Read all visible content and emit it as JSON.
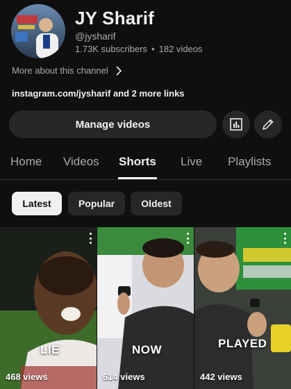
{
  "channel": {
    "name": "JY Sharif",
    "handle": "@jysharif",
    "subscribers": "1.73K subscribers",
    "videos": "182 videos",
    "more_about": "More about this channel",
    "links": "instagram.com/jysharif and 2 more links",
    "avatar_icon": "channel-avatar"
  },
  "actions": {
    "manage_videos": "Manage videos",
    "analytics_icon": "analytics-icon",
    "edit_icon": "pencil-icon"
  },
  "tabs": [
    {
      "label": "Home"
    },
    {
      "label": "Videos"
    },
    {
      "label": "Shorts",
      "active": true
    },
    {
      "label": "Live"
    },
    {
      "label": "Playlists"
    }
  ],
  "filters": [
    {
      "label": "Latest",
      "active": true
    },
    {
      "label": "Popular"
    },
    {
      "label": "Oldest"
    }
  ],
  "shorts": [
    {
      "views": "468 views",
      "overlay": "LIE"
    },
    {
      "views": "614 views",
      "overlay": "NOW"
    },
    {
      "views": "442 views",
      "overlay": "PLAYED"
    }
  ],
  "colors": {
    "background": "#0f0f0f",
    "surface": "#272727",
    "text": "#f1f1f1",
    "secondary_text": "#aaaaaa"
  }
}
